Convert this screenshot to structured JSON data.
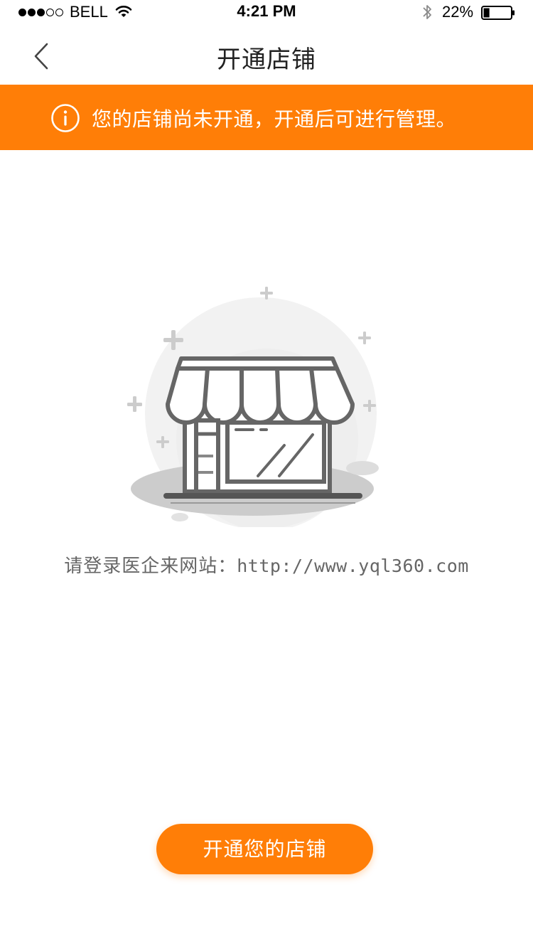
{
  "status_bar": {
    "carrier": "BELL",
    "time": "4:21 PM",
    "battery": "22%",
    "signal_bars_filled": 3,
    "signal_bars_total": 5,
    "battery_level": 0.22
  },
  "nav": {
    "title": "开通店铺",
    "back_icon": "chevron-left-icon"
  },
  "notice": {
    "icon": "info-icon",
    "text": "您的店铺尚未开通，开通后可进行管理。",
    "background_color": "#ff7e07"
  },
  "illustration": {
    "icon": "shop-storefront-illustration"
  },
  "hint": {
    "label": "请登录医企来网站：",
    "url": "http://www.yql360.com"
  },
  "actions": {
    "open_shop_label": "开通您的店铺",
    "accent_color": "#ff7e07"
  }
}
